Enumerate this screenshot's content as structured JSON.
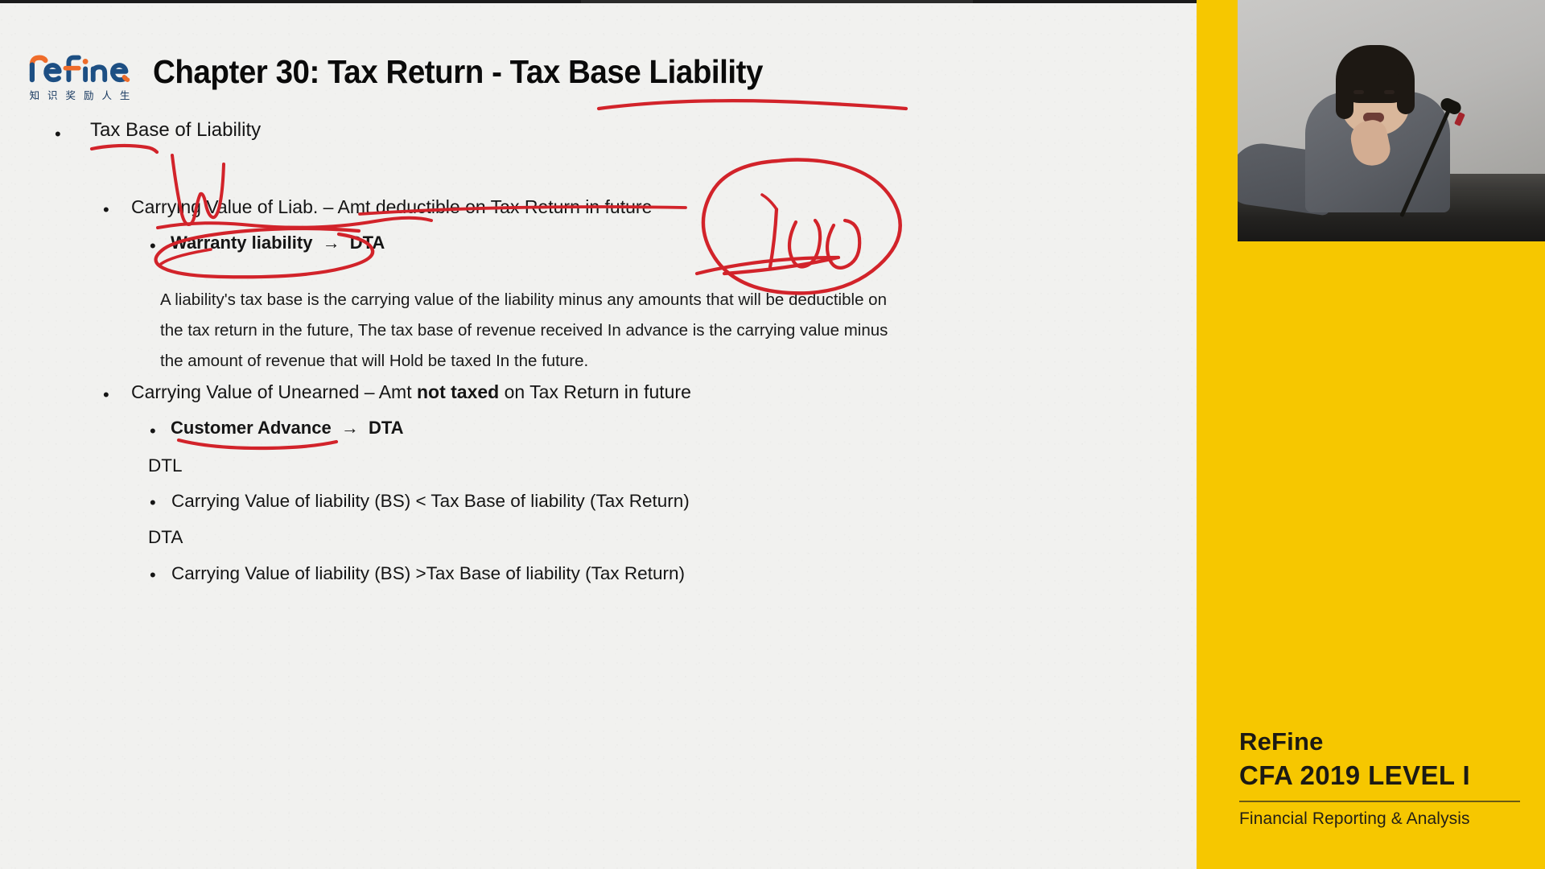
{
  "slide": {
    "logo": {
      "wordmark": "reFine",
      "tagline": "知 识 奖 励 人 生",
      "color_primary": "#1d4f83",
      "color_accent": "#ef6c2a"
    },
    "title": "Chapter 30: Tax Return - Tax Base Liability",
    "lines": {
      "l1": "Tax Base of Liability",
      "l2": "Carrying Value of Liab. – Amt deductible on Tax Return in future",
      "l3_a": "Warranty liability",
      "l3_arrow": "→",
      "l3_b": "DTA",
      "p1": "A liability's tax base is the carrying value of the liability minus any amounts that will be deductible on",
      "p2": "the tax return in the future, The tax base of revenue received In advance is the carrying value minus",
      "p3": "the amount of revenue that will Hold be taxed In the future.",
      "l4_a": "Carrying Value of Unearned – Amt ",
      "l4_bold": "not taxed",
      "l4_b": " on Tax Return in future",
      "l5_a": "Customer Advance",
      "l5_arrow": "→",
      "l5_b": "DTA",
      "l6": "DTL",
      "l7": "Carrying Value of liability (BS) < Tax Base of liability (Tax Return)",
      "l8": "DTA",
      "l9": "Carrying Value of liability (BS) >Tax Base of liability (Tax Return)"
    },
    "bullet_glyph": "•",
    "annotations": {
      "ink_color": "#d2232a",
      "handwritten_number": "100",
      "marks": [
        "underline-under-tax-base-of-liability",
        "checkmark-below-title",
        "underline-under-carrying-value-of-liab",
        "underline-amt-deductible-on-tax-return-in-future",
        "strikethrough-title-area",
        "oval-around-warranty-liability-dta",
        "circled-100",
        "underline-under-customer-advance"
      ]
    }
  },
  "sidebar": {
    "background_color": "#F6C700",
    "video": {
      "label": "instructor-webcam-feed",
      "subject": "lecturer speaking at desk with microphone"
    },
    "brand": {
      "name": "ReFine",
      "course": "CFA 2019 LEVEL I",
      "topic": "Financial Reporting & Analysis"
    }
  }
}
